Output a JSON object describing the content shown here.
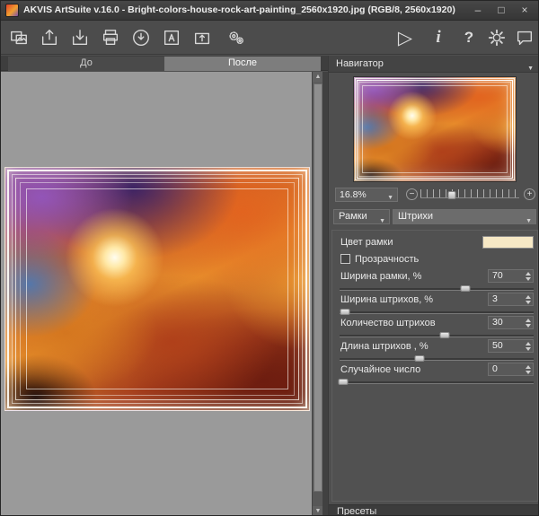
{
  "window": {
    "title": "AKVIS ArtSuite v.16.0 - Bright-colors-house-rock-art-painting_2560x1920.jpg (RGB/8, 2560x1920)",
    "minimize_glyph": "–",
    "maximize_glyph": "□",
    "close_glyph": "×"
  },
  "toolbar": {
    "left_icons": [
      "open-image",
      "export",
      "import",
      "print",
      "download",
      "text-frame",
      "upload",
      "batch-gears"
    ],
    "right_icons": {
      "run_glyph": "▷",
      "info_glyph": "i",
      "help_glyph": "?",
      "settings": "gear-icon",
      "chat": "chat-bubble-icon"
    }
  },
  "tabs": {
    "before": "До",
    "after": "После"
  },
  "navigator": {
    "title": "Навигатор",
    "zoom": "16.8%",
    "zoom_slider_percent": 32,
    "zoom_out_glyph": "−",
    "zoom_in_glyph": "+"
  },
  "effect": {
    "frame_select": "Рамки",
    "style_select": "Штрихи",
    "params": [
      {
        "label": "Цвет рамки",
        "swatch": "#f6e8c5"
      },
      {
        "label": "Прозрачность",
        "checked": false
      },
      {
        "label": "Ширина рамки, %",
        "value": "70",
        "slider": 65
      },
      {
        "label": "Ширина штрихов, %",
        "value": "3",
        "slider": 3
      },
      {
        "label": "Количество штрихов",
        "value": "30",
        "slider": 54
      },
      {
        "label": "Длина штрихов , %",
        "value": "50",
        "slider": 41
      },
      {
        "label": "Случайное число",
        "value": "0",
        "slider": 2
      }
    ]
  },
  "presets": {
    "title": "Пресеты"
  }
}
